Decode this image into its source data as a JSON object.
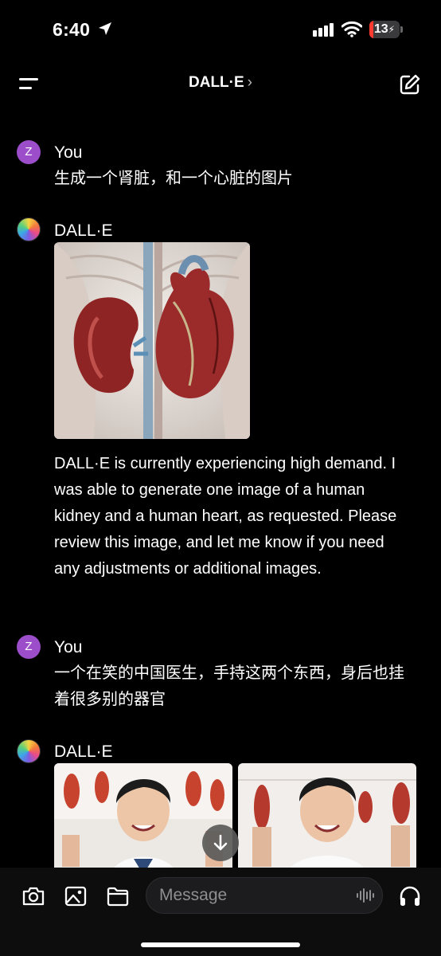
{
  "status": {
    "time": "6:40",
    "battery": "13",
    "battery_level": 0.13
  },
  "header": {
    "title": "DALL·E",
    "chevron": "›"
  },
  "messages": [
    {
      "sender": "You",
      "avatar": "Z",
      "text": "生成一个肾脏，和一个心脏的图片"
    },
    {
      "sender": "DALL·E",
      "text": "DALL·E is currently experiencing high demand. I was able to generate one image of a human kidney and a human heart, as requested. Please review this image, and let me know if you need any adjustments or additional images."
    },
    {
      "sender": "You",
      "avatar": "Z",
      "text": "一个在笑的中国医生，手持这两个东西，身后也挂着很多别的器官"
    },
    {
      "sender": "DALL·E"
    }
  ],
  "composer": {
    "placeholder": "Message"
  },
  "icons": [
    "menu-icon",
    "compose-icon",
    "location-arrow-icon",
    "signal-icon",
    "wifi-icon",
    "camera-icon",
    "image-icon",
    "folder-icon",
    "voice-waveform-icon",
    "headphones-icon",
    "arrow-down-icon"
  ]
}
